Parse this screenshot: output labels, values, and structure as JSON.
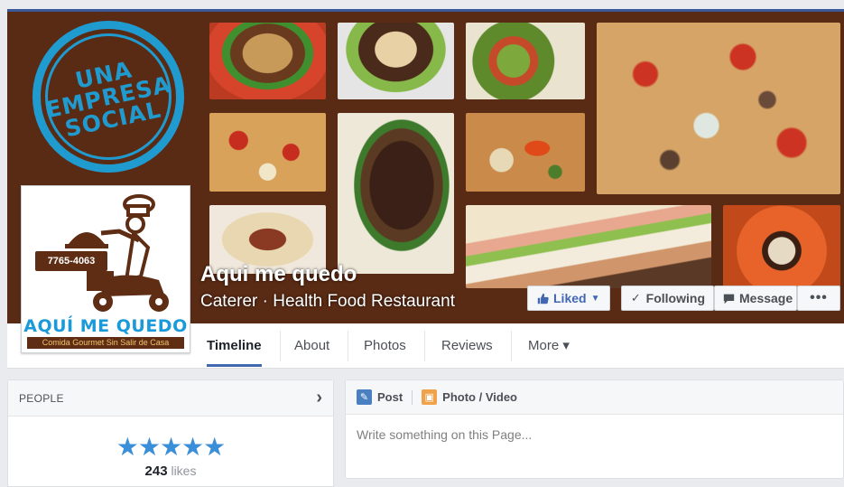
{
  "cover": {
    "stamp_text": "UNA EMPRESA SOCIAL",
    "stamp_color": "#1f9bd0",
    "background_color": "#5a2b14"
  },
  "profile": {
    "phone": "7765-4063",
    "brand": "AQUÍ ME QUEDO",
    "tagline": "Comida Gourmet Sin Salir de Casa"
  },
  "page": {
    "name": "Aqui me quedo",
    "category": "Caterer · Health Food Restaurant"
  },
  "actions": {
    "liked": {
      "label": "Liked",
      "icon": "thumbs-up-icon"
    },
    "following": {
      "label": "Following",
      "icon": "check-icon"
    },
    "message": {
      "label": "Message",
      "icon": "message-icon"
    },
    "more": {
      "label": "•••"
    }
  },
  "nav": {
    "tabs": [
      {
        "label": "Timeline"
      },
      {
        "label": "About"
      },
      {
        "label": "Photos"
      },
      {
        "label": "Reviews"
      },
      {
        "label": "More ▾"
      }
    ],
    "active_color": "#4267b2"
  },
  "people": {
    "title": "PEOPLE",
    "stars": "★★★★★",
    "rating": 5,
    "likes_count": "243",
    "likes_label": "likes"
  },
  "composer": {
    "post_tab": "Post",
    "photo_tab": "Photo / Video",
    "placeholder": "Write something on this Page..."
  }
}
